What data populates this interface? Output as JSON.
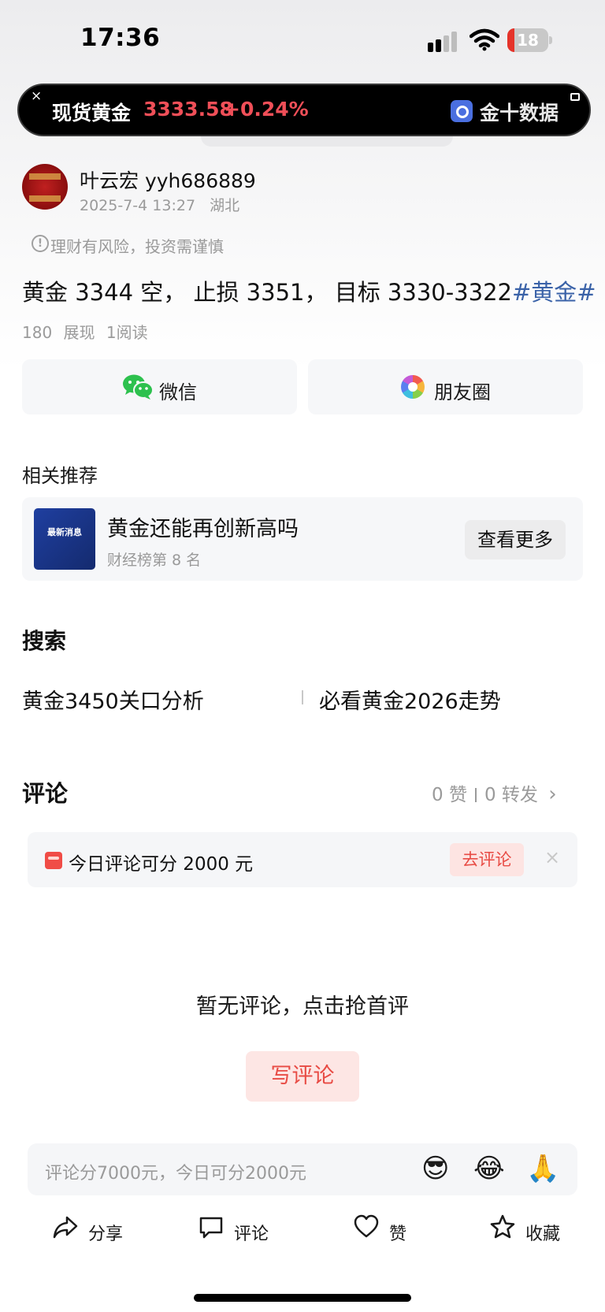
{
  "status_bar": {
    "time": "17:36",
    "battery": "18",
    "battery_level": 0.18
  },
  "ticker": {
    "close": "×",
    "name": "现货黄金",
    "price": "3333.58",
    "change": "+0.24%",
    "source": "金十数据"
  },
  "author": {
    "name": "叶云宏 yyh686889",
    "date": "2025-7-4 13:27",
    "location": "湖北"
  },
  "risk_notice": "理财有风险，投资需谨慎",
  "post": {
    "text": "黄金 3344 空， 止损 3351， 目标 3330-3322",
    "hashtag": "#黄金#"
  },
  "stats": {
    "impressions": "180 展现",
    "reads": "1阅读"
  },
  "share": {
    "wechat": "微信",
    "moments": "朋友圈"
  },
  "related": {
    "section_title": "相关推荐",
    "thumb_text": "最新消息",
    "title": "黄金还能再创新高吗",
    "subtitle": "财经榜第 8 名",
    "more_button": "查看更多"
  },
  "search": {
    "section_title": "搜索",
    "items": [
      "黄金3450关口分析",
      "必看黄金2026走势"
    ]
  },
  "comments": {
    "section_title": "评论",
    "likes": "0 赞",
    "reposts": "0 转发",
    "chevron": "›",
    "promo_text": "今日评论可分 2000 元",
    "promo_button": "去评论",
    "promo_close": "×",
    "empty_text": "暂无评论，点击抢首评",
    "write_button": "写评论"
  },
  "comment_input": {
    "placeholder": "评论分7000元，今日可分2000元",
    "emojis": [
      "😎",
      "😂",
      "🙏"
    ]
  },
  "bottom_bar": {
    "share": "分享",
    "comment": "评论",
    "like": "赞",
    "favorite": "收藏"
  }
}
